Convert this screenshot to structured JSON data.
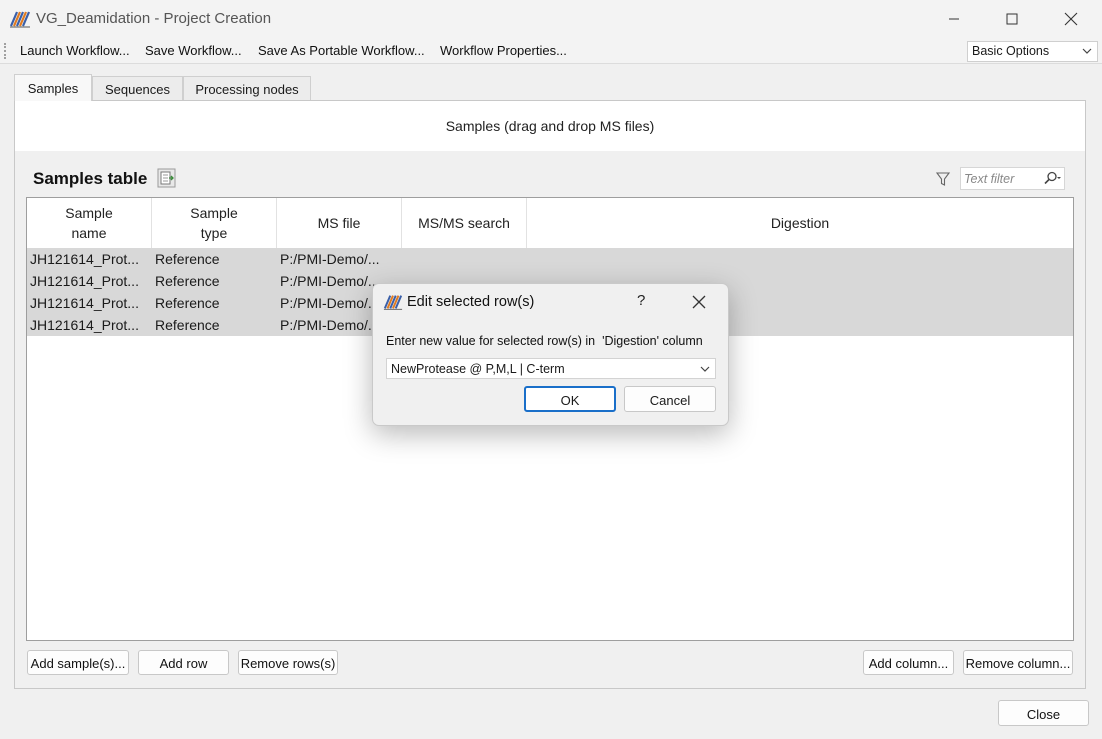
{
  "window": {
    "title": "VG_Deamidation - Project Creation"
  },
  "menu": {
    "items": [
      "Launch Workflow...",
      "Save Workflow...",
      "Save As Portable Workflow...",
      "Workflow Properties..."
    ],
    "mode_selected": "Basic Options"
  },
  "tabs": [
    "Samples",
    "Sequences",
    "Processing nodes"
  ],
  "active_tab": "Samples",
  "drop_banner": "Samples (drag and drop MS files)",
  "samples": {
    "title": "Samples table",
    "filter_placeholder": "Text filter",
    "columns": [
      "Sample\nname",
      "Sample\ntype",
      "MS file",
      "MS/MS search",
      "Digestion"
    ],
    "rows": [
      [
        "JH121614_Prot...",
        "Reference",
        "P:/PMI-Demo/...",
        "",
        ""
      ],
      [
        "JH121614_Prot...",
        "Reference",
        "P:/PMI-Demo/...",
        "",
        ""
      ],
      [
        "JH121614_Prot...",
        "Reference",
        "P:/PMI-Demo/...",
        "",
        ""
      ],
      [
        "JH121614_Prot...",
        "Reference",
        "P:/PMI-Demo/...",
        "",
        ""
      ]
    ],
    "buttons": {
      "add_samples": "Add sample(s)...",
      "add_row": "Add row",
      "remove_rows": "Remove rows(s)",
      "add_column": "Add column...",
      "remove_column": "Remove column..."
    }
  },
  "footer": {
    "close": "Close"
  },
  "dialog": {
    "title": "Edit selected row(s)",
    "help": "?",
    "prompt": "Enter new value for selected row(s) in  'Digestion' column",
    "value": "NewProtease @ P,M,L | C-term",
    "ok": "OK",
    "cancel": "Cancel"
  },
  "colors": {
    "accent": "#1a6fc9",
    "row_selected": "#d8d8d8"
  }
}
